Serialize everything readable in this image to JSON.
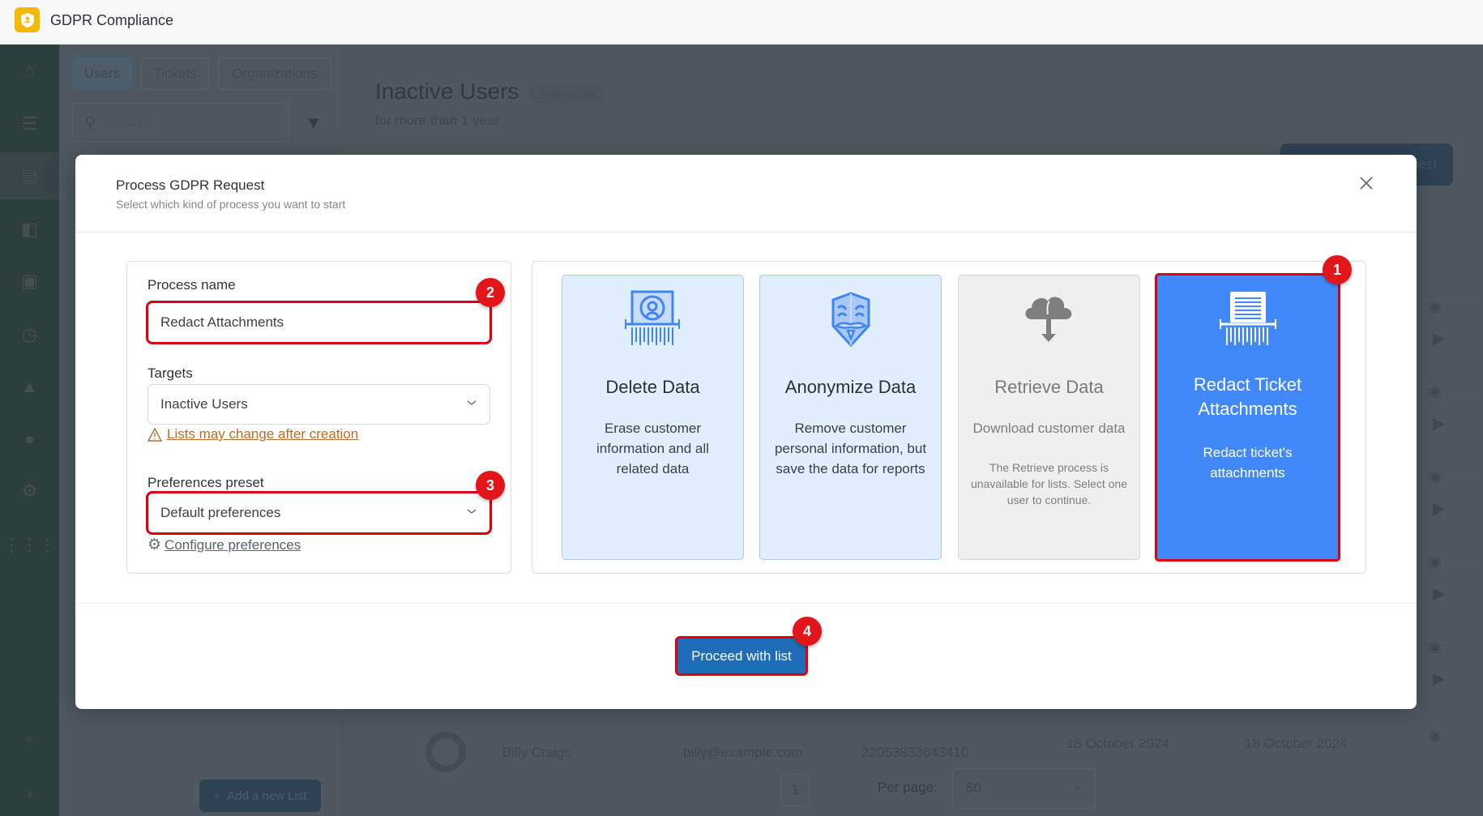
{
  "app": {
    "title": "GDPR Compliance",
    "logo_icon": "shield-user-icon"
  },
  "sidebar": {
    "items": [
      {
        "name": "home",
        "icon": "home-icon"
      },
      {
        "name": "lists",
        "icon": "list-icon"
      },
      {
        "name": "inbox",
        "icon": "inbox-icon",
        "active": true
      },
      {
        "name": "contacts",
        "icon": "contact-book-icon"
      },
      {
        "name": "badge",
        "icon": "id-badge-icon"
      },
      {
        "name": "history",
        "icon": "clock-icon"
      },
      {
        "name": "reports",
        "icon": "chart-icon"
      },
      {
        "name": "user-lock",
        "icon": "user-lock-icon"
      },
      {
        "name": "settings",
        "icon": "gear-icon"
      },
      {
        "name": "apps",
        "icon": "grid-icon"
      },
      {
        "name": "feedback",
        "icon": "chat-icon"
      },
      {
        "name": "expand",
        "icon": "chevron-right-icon"
      }
    ]
  },
  "background": {
    "tabs": [
      "Users",
      "Tickets",
      "Organizations"
    ],
    "search_placeholder": "Search",
    "add_list_label": "Add a new List",
    "page_title": "Inactive Users",
    "result_count": "106 results",
    "page_subtitle": "for more than 1 year",
    "process_request_label": "Process Request",
    "last_row": {
      "name": "Billy Craigs",
      "email": "billy@example.com",
      "id": "22053833643410",
      "created": "18 October 2024",
      "updated": "18 October 2024"
    },
    "pagination": {
      "current_page": "1",
      "per_page_label": "Per page:",
      "per_page_value": "50"
    }
  },
  "modal": {
    "title": "Process GDPR Request",
    "subtitle": "Select which kind of process you want to start",
    "form": {
      "process_name_label": "Process name",
      "process_name_value": "Redact Attachments",
      "targets_label": "Targets",
      "targets_value": "Inactive Users",
      "targets_warning": "Lists may change after creation",
      "preferences_label": "Preferences preset",
      "preferences_value": "Default preferences",
      "configure_link": "Configure preferences"
    },
    "cards": [
      {
        "title": "Delete Data",
        "description": "Erase customer information and all related data",
        "state": "available",
        "icon": "shredder-user-icon"
      },
      {
        "title": "Anonymize Data",
        "description": "Remove customer personal information, but save the data for reports",
        "state": "available",
        "icon": "mask-icon"
      },
      {
        "title": "Retrieve Data",
        "description": "Download customer data",
        "note": "The Retrieve process is unavailable for lists. Select one user to continue.",
        "state": "disabled",
        "icon": "cloud-download-icon"
      },
      {
        "title": "Redact Ticket Attachments",
        "description": "Redact ticket's attachments",
        "state": "selected",
        "icon": "shredder-document-icon"
      }
    ],
    "proceed_label": "Proceed with list"
  },
  "annotations": {
    "badges": [
      "1",
      "2",
      "3",
      "4"
    ],
    "highlight_color": "#e0000d"
  },
  "colors": {
    "primary": "#1f6db8",
    "selected_card": "#4189fb",
    "warning": "#b76e2c",
    "logo": "#f5b800"
  }
}
